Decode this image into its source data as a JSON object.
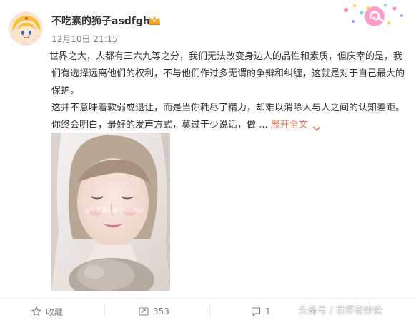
{
  "header": {
    "username": "不吃素的狮子asdfgh",
    "timestamp": "12月10日 21:15",
    "vip_badge_icon": "vip-crown-icon",
    "decoration_icon": "leo-zodiac-sticker-icon"
  },
  "post": {
    "paragraph_1": "世界之大，人都有三六九等之分，我们无法改变身边人的品性和素质，但庆幸的是，我们有选择远离他们的权利，不与他们作过多无谓的争辩和纠缠，这就是对于自己最大的保护。",
    "paragraph_2": "这并不意味着软弱或退让，而是当你耗尽了精力，却难以消除人与人之间的认知差距。你终会明白，最好的发声方式，莫过于少说话，做 ...",
    "expand_label": "展开全文",
    "photo_watermark": "@不吃素的狮子asdfgh",
    "photo_icon": "selfie-photo"
  },
  "actions": {
    "favorite_label": "收藏",
    "repost_count": "353",
    "comment_count": "1"
  },
  "watermark": "头条号 / 世界奇妙说",
  "colors": {
    "accent": "#eb7350",
    "text": "#333333",
    "muted": "#808080"
  }
}
